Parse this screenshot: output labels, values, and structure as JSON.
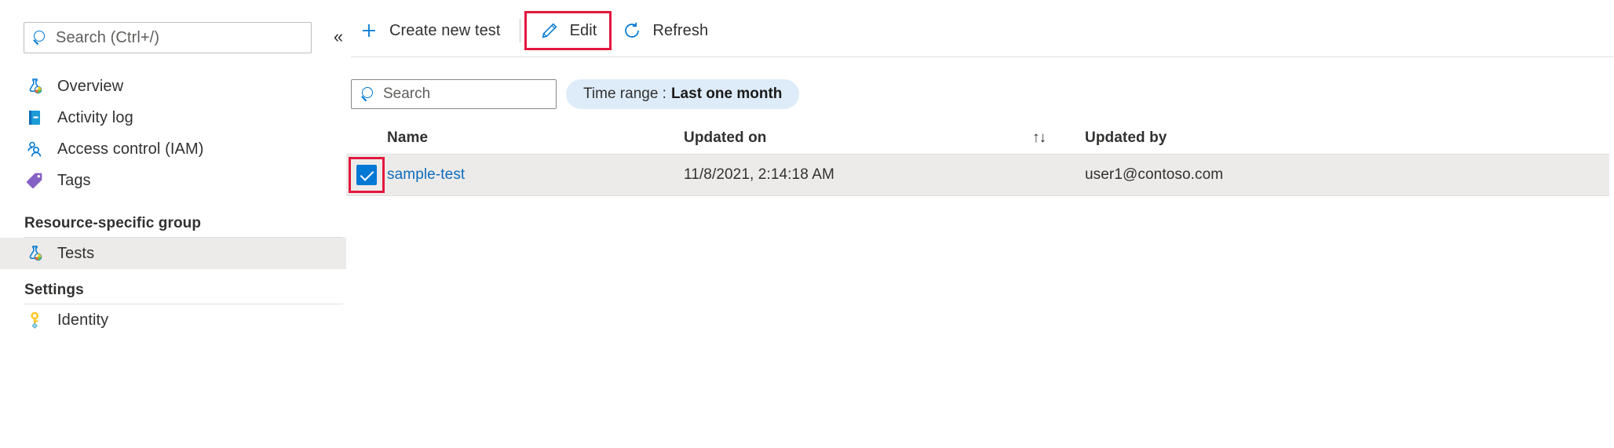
{
  "sidebar": {
    "search": {
      "placeholder": "Search (Ctrl+/)",
      "value": ""
    },
    "collapse_label": "«",
    "items": [
      {
        "label": "Overview",
        "icon": "flask-overview-icon"
      },
      {
        "label": "Activity log",
        "icon": "activity-log-icon"
      },
      {
        "label": "Access control (IAM)",
        "icon": "access-control-icon"
      },
      {
        "label": "Tags",
        "icon": "tag-icon"
      }
    ],
    "groups": [
      {
        "header": "Resource-specific group",
        "items": [
          {
            "label": "Tests",
            "icon": "flask-test-icon",
            "selected": true
          }
        ]
      },
      {
        "header": "Settings",
        "items": [
          {
            "label": "Identity",
            "icon": "key-identity-icon",
            "selected": false
          }
        ]
      }
    ]
  },
  "toolbar": {
    "create_label": "Create new test",
    "edit_label": "Edit",
    "refresh_label": "Refresh",
    "highlight_color": "#e3173e"
  },
  "filters": {
    "search": {
      "placeholder": "Search",
      "value": ""
    },
    "time_range": {
      "label": "Time range :",
      "value": "Last one month"
    }
  },
  "grid": {
    "columns": {
      "name": "Name",
      "updated_on": "Updated on",
      "sort_icon": "↑↓",
      "updated_by": "Updated by"
    },
    "rows": [
      {
        "selected": true,
        "name": "sample-test",
        "updated_on": "11/8/2021, 2:14:18 AM",
        "updated_by": "user1@contoso.com"
      }
    ]
  },
  "colors": {
    "accent": "#0078d4",
    "link": "#0f6cbd",
    "selected_row": "#edebe9",
    "pill_bg": "#deecf9",
    "highlight": "#e3173e"
  }
}
